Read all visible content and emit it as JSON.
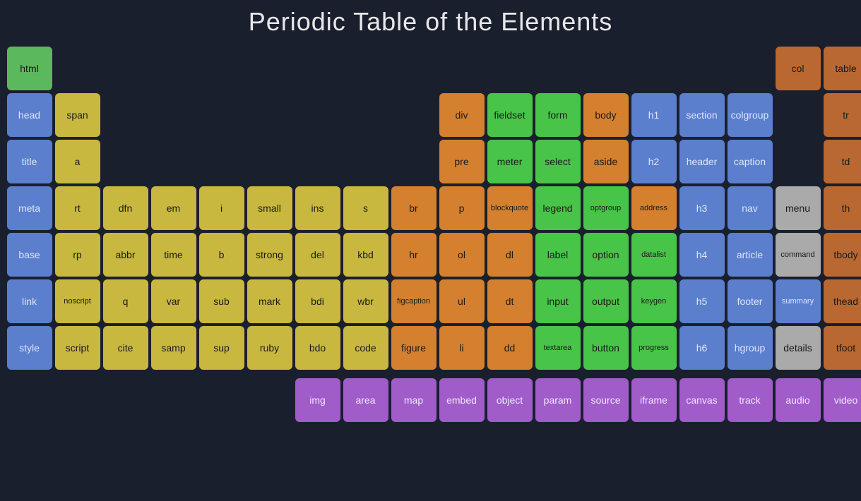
{
  "title": "Periodic Table of the Elements",
  "elements": [
    {
      "symbol": "html",
      "col": 1,
      "row": 1,
      "color": "c-green"
    },
    {
      "symbol": "col",
      "col": 17,
      "row": 1,
      "color": "c-brown"
    },
    {
      "symbol": "table",
      "col": 18,
      "row": 1,
      "color": "c-brown"
    },
    {
      "symbol": "head",
      "col": 1,
      "row": 2,
      "color": "c-blue"
    },
    {
      "symbol": "span",
      "col": 2,
      "row": 2,
      "color": "c-yellow"
    },
    {
      "symbol": "div",
      "col": 10,
      "row": 2,
      "color": "c-orange"
    },
    {
      "symbol": "fieldset",
      "col": 11,
      "row": 2,
      "color": "c-lgreen"
    },
    {
      "symbol": "form",
      "col": 12,
      "row": 2,
      "color": "c-lgreen"
    },
    {
      "symbol": "body",
      "col": 13,
      "row": 2,
      "color": "c-orange"
    },
    {
      "symbol": "h1",
      "col": 14,
      "row": 2,
      "color": "c-blue"
    },
    {
      "symbol": "section",
      "col": 15,
      "row": 2,
      "color": "c-blue"
    },
    {
      "symbol": "colgroup",
      "col": 16,
      "row": 2,
      "color": "c-blue"
    },
    {
      "symbol": "tr",
      "col": 18,
      "row": 2,
      "color": "c-brown"
    },
    {
      "symbol": "title",
      "col": 1,
      "row": 3,
      "color": "c-blue"
    },
    {
      "symbol": "a",
      "col": 2,
      "row": 3,
      "color": "c-yellow"
    },
    {
      "symbol": "pre",
      "col": 10,
      "row": 3,
      "color": "c-orange"
    },
    {
      "symbol": "meter",
      "col": 11,
      "row": 3,
      "color": "c-lgreen"
    },
    {
      "symbol": "select",
      "col": 12,
      "row": 3,
      "color": "c-lgreen"
    },
    {
      "symbol": "aside",
      "col": 13,
      "row": 3,
      "color": "c-orange"
    },
    {
      "symbol": "h2",
      "col": 14,
      "row": 3,
      "color": "c-blue"
    },
    {
      "symbol": "header",
      "col": 15,
      "row": 3,
      "color": "c-blue"
    },
    {
      "symbol": "caption",
      "col": 16,
      "row": 3,
      "color": "c-blue"
    },
    {
      "symbol": "td",
      "col": 18,
      "row": 3,
      "color": "c-brown"
    },
    {
      "symbol": "meta",
      "col": 1,
      "row": 4,
      "color": "c-blue"
    },
    {
      "symbol": "rt",
      "col": 2,
      "row": 4,
      "color": "c-yellow"
    },
    {
      "symbol": "dfn",
      "col": 3,
      "row": 4,
      "color": "c-yellow"
    },
    {
      "symbol": "em",
      "col": 4,
      "row": 4,
      "color": "c-yellow"
    },
    {
      "symbol": "i",
      "col": 5,
      "row": 4,
      "color": "c-yellow"
    },
    {
      "symbol": "small",
      "col": 6,
      "row": 4,
      "color": "c-yellow"
    },
    {
      "symbol": "ins",
      "col": 7,
      "row": 4,
      "color": "c-yellow"
    },
    {
      "symbol": "s",
      "col": 8,
      "row": 4,
      "color": "c-yellow"
    },
    {
      "symbol": "br",
      "col": 9,
      "row": 4,
      "color": "c-orange"
    },
    {
      "symbol": "p",
      "col": 10,
      "row": 4,
      "color": "c-orange"
    },
    {
      "symbol": "blockquote",
      "col": 11,
      "row": 4,
      "color": "c-orange",
      "small": true
    },
    {
      "symbol": "legend",
      "col": 12,
      "row": 4,
      "color": "c-lgreen"
    },
    {
      "symbol": "optgroup",
      "col": 13,
      "row": 4,
      "color": "c-lgreen",
      "small": true
    },
    {
      "symbol": "address",
      "col": 14,
      "row": 4,
      "color": "c-orange",
      "small": true
    },
    {
      "symbol": "h3",
      "col": 15,
      "row": 4,
      "color": "c-blue"
    },
    {
      "symbol": "nav",
      "col": 16,
      "row": 4,
      "color": "c-blue"
    },
    {
      "symbol": "menu",
      "col": 17,
      "row": 4,
      "color": "c-lgray"
    },
    {
      "symbol": "th",
      "col": 18,
      "row": 4,
      "color": "c-brown"
    },
    {
      "symbol": "base",
      "col": 1,
      "row": 5,
      "color": "c-blue"
    },
    {
      "symbol": "rp",
      "col": 2,
      "row": 5,
      "color": "c-yellow"
    },
    {
      "symbol": "abbr",
      "col": 3,
      "row": 5,
      "color": "c-yellow"
    },
    {
      "symbol": "time",
      "col": 4,
      "row": 5,
      "color": "c-yellow"
    },
    {
      "symbol": "b",
      "col": 5,
      "row": 5,
      "color": "c-yellow"
    },
    {
      "symbol": "strong",
      "col": 6,
      "row": 5,
      "color": "c-yellow"
    },
    {
      "symbol": "del",
      "col": 7,
      "row": 5,
      "color": "c-yellow"
    },
    {
      "symbol": "kbd",
      "col": 8,
      "row": 5,
      "color": "c-yellow"
    },
    {
      "symbol": "hr",
      "col": 9,
      "row": 5,
      "color": "c-orange"
    },
    {
      "symbol": "ol",
      "col": 10,
      "row": 5,
      "color": "c-orange"
    },
    {
      "symbol": "dl",
      "col": 11,
      "row": 5,
      "color": "c-orange"
    },
    {
      "symbol": "label",
      "col": 12,
      "row": 5,
      "color": "c-lgreen"
    },
    {
      "symbol": "option",
      "col": 13,
      "row": 5,
      "color": "c-lgreen"
    },
    {
      "symbol": "datalist",
      "col": 14,
      "row": 5,
      "color": "c-lgreen",
      "small": true
    },
    {
      "symbol": "h4",
      "col": 15,
      "row": 5,
      "color": "c-blue"
    },
    {
      "symbol": "article",
      "col": 16,
      "row": 5,
      "color": "c-blue"
    },
    {
      "symbol": "command",
      "col": 17,
      "row": 5,
      "color": "c-lgray",
      "small": true
    },
    {
      "symbol": "tbody",
      "col": 18,
      "row": 5,
      "color": "c-brown"
    },
    {
      "symbol": "link",
      "col": 1,
      "row": 6,
      "color": "c-blue"
    },
    {
      "symbol": "noscript",
      "col": 2,
      "row": 6,
      "color": "c-yellow",
      "small": true
    },
    {
      "symbol": "q",
      "col": 3,
      "row": 6,
      "color": "c-yellow"
    },
    {
      "symbol": "var",
      "col": 4,
      "row": 6,
      "color": "c-yellow"
    },
    {
      "symbol": "sub",
      "col": 5,
      "row": 6,
      "color": "c-yellow"
    },
    {
      "symbol": "mark",
      "col": 6,
      "row": 6,
      "color": "c-yellow"
    },
    {
      "symbol": "bdi",
      "col": 7,
      "row": 6,
      "color": "c-yellow"
    },
    {
      "symbol": "wbr",
      "col": 8,
      "row": 6,
      "color": "c-yellow"
    },
    {
      "symbol": "figcaption",
      "col": 9,
      "row": 6,
      "color": "c-orange",
      "small": true
    },
    {
      "symbol": "ul",
      "col": 10,
      "row": 6,
      "color": "c-orange"
    },
    {
      "symbol": "dt",
      "col": 11,
      "row": 6,
      "color": "c-orange"
    },
    {
      "symbol": "input",
      "col": 12,
      "row": 6,
      "color": "c-lgreen"
    },
    {
      "symbol": "output",
      "col": 13,
      "row": 6,
      "color": "c-lgreen"
    },
    {
      "symbol": "keygen",
      "col": 14,
      "row": 6,
      "color": "c-lgreen",
      "small": true
    },
    {
      "symbol": "h5",
      "col": 15,
      "row": 6,
      "color": "c-blue"
    },
    {
      "symbol": "footer",
      "col": 16,
      "row": 6,
      "color": "c-blue"
    },
    {
      "symbol": "summary",
      "col": 17,
      "row": 6,
      "color": "c-blue",
      "small": true
    },
    {
      "symbol": "thead",
      "col": 18,
      "row": 6,
      "color": "c-brown"
    },
    {
      "symbol": "style",
      "col": 1,
      "row": 7,
      "color": "c-blue"
    },
    {
      "symbol": "script",
      "col": 2,
      "row": 7,
      "color": "c-yellow"
    },
    {
      "symbol": "cite",
      "col": 3,
      "row": 7,
      "color": "c-yellow"
    },
    {
      "symbol": "samp",
      "col": 4,
      "row": 7,
      "color": "c-yellow"
    },
    {
      "symbol": "sup",
      "col": 5,
      "row": 7,
      "color": "c-yellow"
    },
    {
      "symbol": "ruby",
      "col": 6,
      "row": 7,
      "color": "c-yellow"
    },
    {
      "symbol": "bdo",
      "col": 7,
      "row": 7,
      "color": "c-yellow"
    },
    {
      "symbol": "code",
      "col": 8,
      "row": 7,
      "color": "c-yellow"
    },
    {
      "symbol": "figure",
      "col": 9,
      "row": 7,
      "color": "c-orange"
    },
    {
      "symbol": "li",
      "col": 10,
      "row": 7,
      "color": "c-orange"
    },
    {
      "symbol": "dd",
      "col": 11,
      "row": 7,
      "color": "c-orange"
    },
    {
      "symbol": "textarea",
      "col": 12,
      "row": 7,
      "color": "c-lgreen",
      "small": true
    },
    {
      "symbol": "button",
      "col": 13,
      "row": 7,
      "color": "c-lgreen"
    },
    {
      "symbol": "progress",
      "col": 14,
      "row": 7,
      "color": "c-lgreen",
      "small": true
    },
    {
      "symbol": "h6",
      "col": 15,
      "row": 7,
      "color": "c-blue"
    },
    {
      "symbol": "hgroup",
      "col": 16,
      "row": 7,
      "color": "c-blue"
    },
    {
      "symbol": "details",
      "col": 17,
      "row": 7,
      "color": "c-lgray"
    },
    {
      "symbol": "tfoot",
      "col": 18,
      "row": 7,
      "color": "c-brown"
    }
  ],
  "media_elements": [
    {
      "symbol": "img",
      "color": "c-purple"
    },
    {
      "symbol": "area",
      "color": "c-purple"
    },
    {
      "symbol": "map",
      "color": "c-purple"
    },
    {
      "symbol": "embed",
      "color": "c-purple"
    },
    {
      "symbol": "object",
      "color": "c-purple"
    },
    {
      "symbol": "param",
      "color": "c-purple"
    },
    {
      "symbol": "source",
      "color": "c-purple"
    },
    {
      "symbol": "iframe",
      "color": "c-purple"
    },
    {
      "symbol": "canvas",
      "color": "c-purple"
    },
    {
      "symbol": "track",
      "color": "c-purple"
    },
    {
      "symbol": "audio",
      "color": "c-purple"
    },
    {
      "symbol": "video",
      "color": "c-purple"
    }
  ]
}
